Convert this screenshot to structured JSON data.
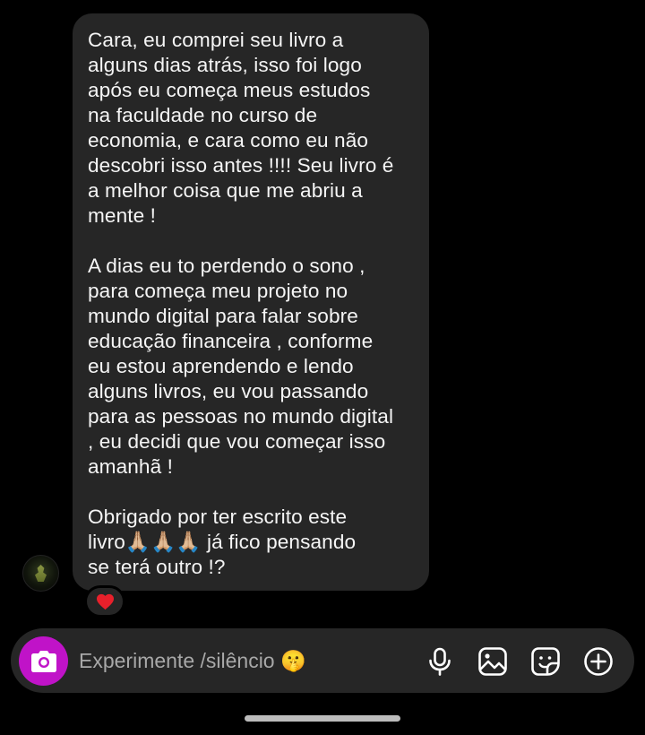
{
  "message": {
    "paragraphs": [
      "Cara, eu comprei seu livro a\nalguns dias atrás, isso foi logo\napós eu começa meus estudos\nna faculdade no curso de\neconomia, e cara como eu não\ndescobri isso antes !!!! Seu livro é\na melhor coisa que me abriu a\nmente !",
      "A dias eu to perdendo o sono ,\npara começa meu projeto no\nmundo digital para falar sobre\neducação financeira , conforme\neu estou aprendendo e lendo\nalguns livros, eu vou passando\npara as pessoas no mundo digital\n, eu decidi que vou começar isso\namanhã !",
      "Obrigado por ter escrito este\nlivro🙏🏼🙏🏼🙏🏼 já fico pensando\nse terá outro !?"
    ],
    "reaction": "heart"
  },
  "sender": {
    "avatar": "avatar"
  },
  "composer": {
    "placeholder": "Experimente /silêncio 🤫",
    "icons": [
      "camera-icon",
      "microphone-icon",
      "gallery-icon",
      "sticker-icon",
      "add-icon"
    ],
    "camera_color": "#c013c8"
  },
  "colors": {
    "background": "#000000",
    "bubble": "#262626",
    "reaction_heart": "#e8202b"
  }
}
